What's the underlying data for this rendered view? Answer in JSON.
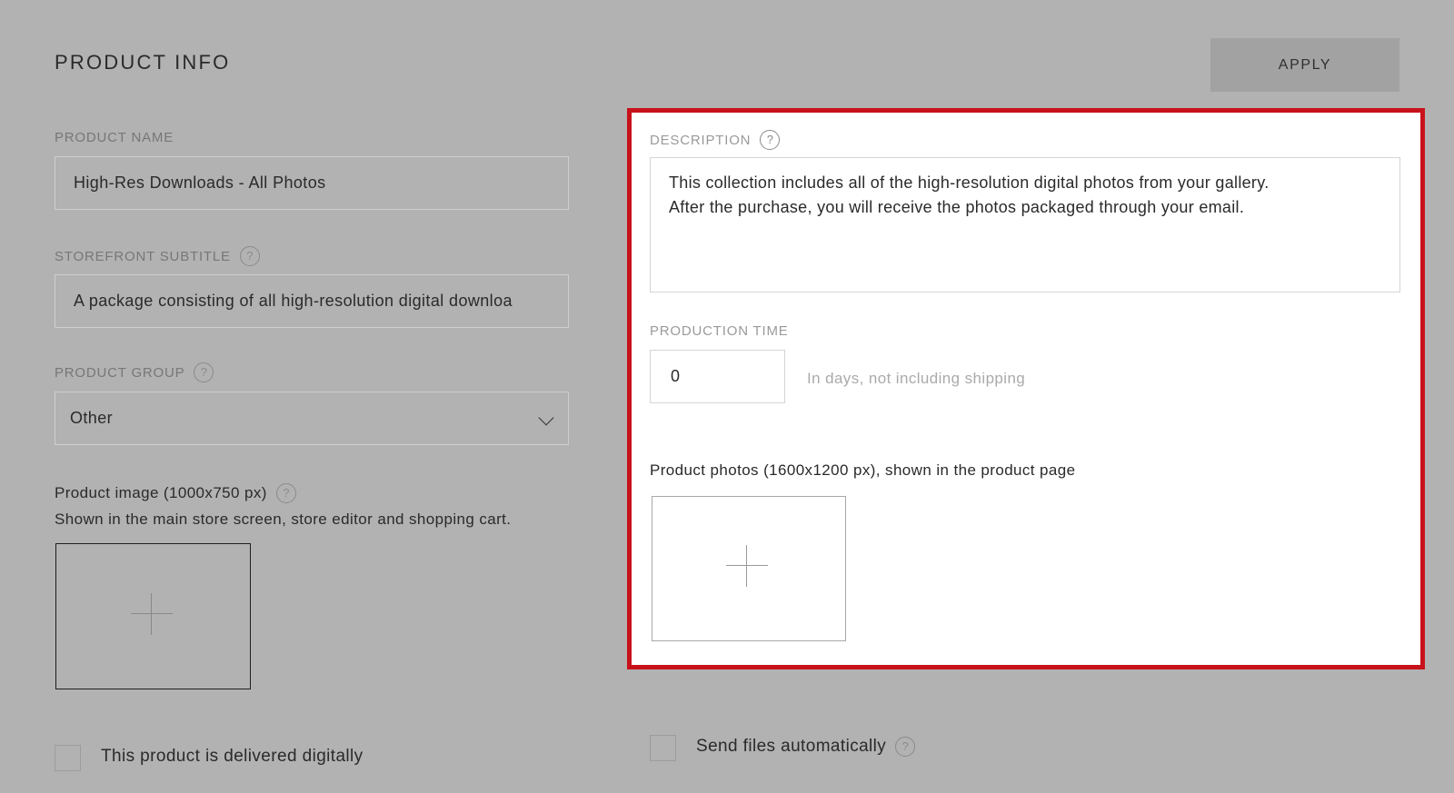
{
  "header": {
    "title": "PRODUCT INFO",
    "apply_label": "APPLY"
  },
  "left": {
    "product_name": {
      "label": "PRODUCT NAME",
      "value": "High-Res Downloads - All Photos"
    },
    "storefront_subtitle": {
      "label": "STOREFRONT SUBTITLE",
      "value": "A package consisting of all high-resolution digital downloa"
    },
    "product_group": {
      "label": "PRODUCT GROUP",
      "value": "Other"
    },
    "product_image": {
      "title": "Product image (1000x750 px)",
      "caption": "Shown in the main store screen, store editor and shopping cart."
    },
    "digital_checkbox_label": "This product is delivered digitally"
  },
  "right": {
    "description": {
      "label": "DESCRIPTION",
      "lines": [
        "This collection includes all of the high-resolution digital photos from your gallery.",
        "After the purchase, you will receive the photos packaged through your email."
      ]
    },
    "production_time": {
      "label": "PRODUCTION TIME",
      "value": "0",
      "hint": "In days, not including shipping"
    },
    "product_photos_label": "Product photos (1600x1200 px), shown in the product page",
    "send_files_label": "Send files automatically"
  },
  "help_glyph": "?",
  "colors": {
    "background": "#b2b2b2",
    "highlight_border": "#c8121b",
    "panel": "#ffffff"
  }
}
